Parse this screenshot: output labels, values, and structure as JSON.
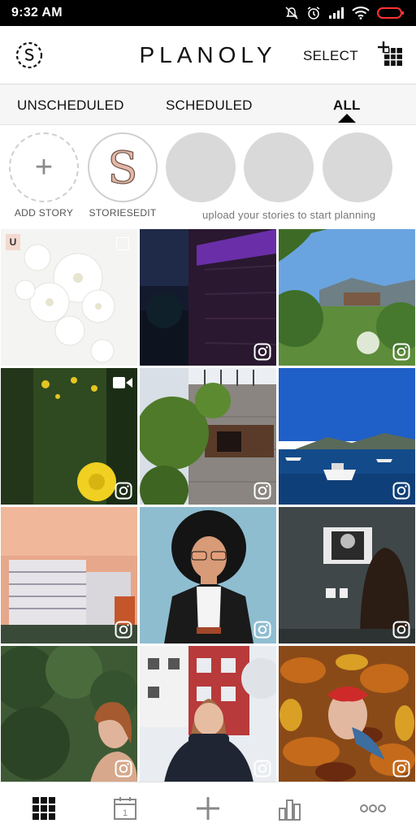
{
  "status_bar": {
    "time": "9:32 AM"
  },
  "header": {
    "brand": "PLANOLY",
    "select_label": "SELECT"
  },
  "tabs": [
    {
      "label": "UNSCHEDULED",
      "active": false
    },
    {
      "label": "SCHEDULED",
      "active": false
    },
    {
      "label": "ALL",
      "active": true
    }
  ],
  "stories": {
    "add_label": "ADD STORY",
    "add_glyph": "+",
    "edit_label": "STORIESEDIT",
    "edit_monogram": "S",
    "hint": "upload your stories to start planning"
  },
  "grid": {
    "unscheduled_badge": "U",
    "tiles": [
      {
        "subject": "white chrysanthemums",
        "badge": "U",
        "source_icon": "none"
      },
      {
        "subject": "night building purple light",
        "source_icon": "instagram-icon"
      },
      {
        "subject": "garden with mountains",
        "source_icon": "instagram-icon"
      },
      {
        "subject": "grass and dandelions",
        "source_icon": "instagram-icon",
        "media": "video-icon"
      },
      {
        "subject": "stone house with plants",
        "source_icon": "instagram-icon"
      },
      {
        "subject": "boats on blue sea",
        "source_icon": "instagram-icon"
      },
      {
        "subject": "hotel at sunset",
        "source_icon": "instagram-icon"
      },
      {
        "subject": "illustrated woman",
        "source_icon": "instagram-icon"
      },
      {
        "subject": "woman in gallery",
        "source_icon": "instagram-icon"
      },
      {
        "subject": "girl in foliage",
        "source_icon": "instagram-icon"
      },
      {
        "subject": "girl in snowy street",
        "source_icon": "instagram-icon"
      },
      {
        "subject": "autumn leaves portrait",
        "source_icon": "instagram-icon"
      }
    ]
  },
  "bottom_nav": {
    "calendar_day": "1",
    "items": [
      "grid-icon",
      "calendar-icon",
      "plus-icon",
      "analytics-icon",
      "more-icon"
    ]
  },
  "colors": {
    "accent_black": "#111111",
    "placeholder_gray": "#d9d9d9",
    "badge_pink": "#f3d9cf",
    "tab_bg": "#f6f6f6"
  }
}
